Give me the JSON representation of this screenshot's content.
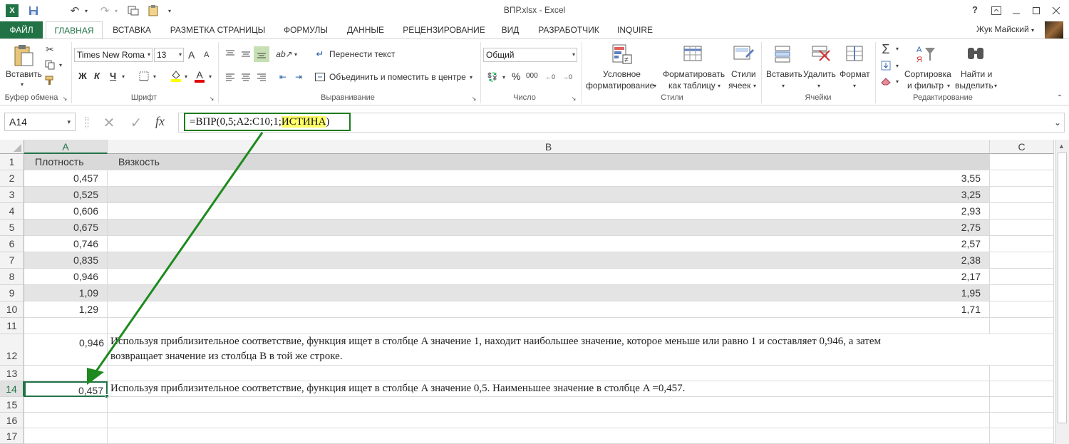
{
  "window": {
    "title": "ВПР.xlsx - Excel",
    "help": "?",
    "user": "Жук Майский"
  },
  "tabs": [
    "ФАЙЛ",
    "ГЛАВНАЯ",
    "ВСТАВКА",
    "РАЗМЕТКА СТРАНИЦЫ",
    "ФОРМУЛЫ",
    "ДАННЫЕ",
    "РЕЦЕНЗИРОВАНИЕ",
    "ВИД",
    "РАЗРАБОТЧИК",
    "INQUIRE"
  ],
  "ribbon": {
    "clipboard": {
      "paste": "Вставить",
      "label": "Буфер обмена"
    },
    "font": {
      "name": "Times New Roma",
      "size": "13",
      "bold": "Ж",
      "italic": "К",
      "underline": "Ч",
      "grow": "A",
      "shrink": "A",
      "color_a": "A",
      "label": "Шрифт"
    },
    "alignment": {
      "wrap": "Перенести текст",
      "merge": "Объединить и поместить в центре",
      "label": "Выравнивание"
    },
    "number": {
      "format": "Общий",
      "percent": "%",
      "thousands": "000",
      "label": "Число"
    },
    "styles": {
      "cond1": "Условное",
      "cond2": "форматирование",
      "fmt1": "Форматировать",
      "fmt2": "как таблицу",
      "cell1": "Стили",
      "cell2": "ячеек",
      "label": "Стили"
    },
    "cells": {
      "insert": "Вставить",
      "delete": "Удалить",
      "format": "Формат",
      "label": "Ячейки"
    },
    "editing": {
      "sort1": "Сортировка",
      "sort2": "и фильтр",
      "find1": "Найти и",
      "find2": "выделить",
      "label": "Редактирование"
    }
  },
  "formula_bar": {
    "name_box": "A14",
    "fx": "fx",
    "formula_prefix": "=ВПР(0,5;A2:C10;1;",
    "formula_highlight": "ИСТИНА",
    "formula_suffix": ")"
  },
  "columns": [
    "A",
    "B",
    "C"
  ],
  "rows": [
    "1",
    "2",
    "3",
    "4",
    "5",
    "6",
    "7",
    "8",
    "9",
    "10",
    "11",
    "12",
    "13",
    "14",
    "15",
    "16",
    "17"
  ],
  "table": {
    "header_a": "Плотность",
    "header_b": "Вязкость",
    "data": [
      {
        "a": "0,457",
        "b": "3,55"
      },
      {
        "a": "0,525",
        "b": "3,25"
      },
      {
        "a": "0,606",
        "b": "2,93"
      },
      {
        "a": "0,675",
        "b": "2,75"
      },
      {
        "a": "0,746",
        "b": "2,57"
      },
      {
        "a": "0,835",
        "b": "2,38"
      },
      {
        "a": "0,946",
        "b": "2,17"
      },
      {
        "a": "1,09",
        "b": "1,95"
      },
      {
        "a": "1,29",
        "b": "1,71"
      }
    ]
  },
  "row12": {
    "value": "0,946",
    "note_line1": "Используя приблизительное соответствие, функция ищет в столбце A значение 1, находит наибольшее значение, которое меньше или равно 1 и составляет 0,946, а затем",
    "note_line2": "возвращает значение из столбца B в той же строке."
  },
  "row14": {
    "value": "0,457",
    "note": "Используя приблизительное соответствие, функция ищет в столбце A значение 0,5. Наименьшее значение в столбце A =0,457."
  },
  "colors": {
    "excel_green": "#217346",
    "annotation_green": "#1e8a1e",
    "highlight": "#ffff66"
  }
}
